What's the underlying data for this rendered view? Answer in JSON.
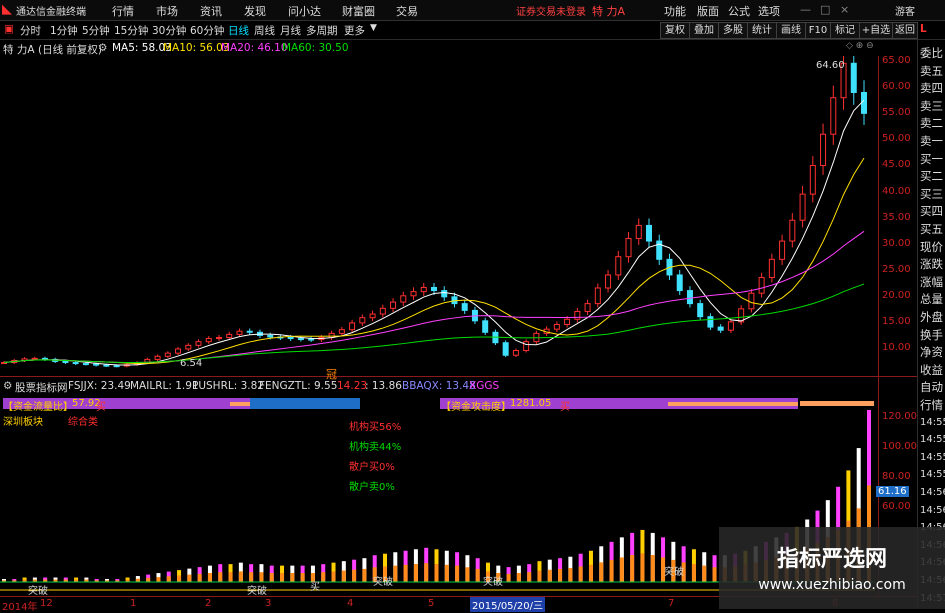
{
  "menubar": {
    "app_title": "通达信金融终端",
    "items": [
      "行情",
      "市场",
      "资讯",
      "发现",
      "问小达",
      "财富圈",
      "交易"
    ],
    "status": "证券交易未登录",
    "stock": "特 力A",
    "right_items": [
      "功能",
      "版面",
      "公式",
      "选项"
    ],
    "guest": "游客"
  },
  "periodbar": {
    "tabs": [
      "分时",
      "1分钟",
      "5分钟",
      "15分钟",
      "30分钟",
      "60分钟",
      "日线",
      "周线",
      "月线",
      "多周期",
      "更多"
    ],
    "active": "日线",
    "buttons": [
      "复权",
      "叠加",
      "多股",
      "统计",
      "画线",
      "F10",
      "标记",
      "+自选",
      "返回"
    ]
  },
  "price_panel": {
    "stock_label": "特 力A",
    "mode": "(日线 前复权)",
    "ma": [
      {
        "label": "MA5: 58.03",
        "color": "#ffffff"
      },
      {
        "label": "MA10: 56.03",
        "color": "#ffe000"
      },
      {
        "label": "MA20: 46.10",
        "color": "#ff40ff"
      },
      {
        "label": "MA60: 30.50",
        "color": "#00dd00"
      }
    ],
    "high_label": "64.60",
    "low_label": "6.54",
    "y_ticks": [
      "65.00",
      "60.00",
      "55.00",
      "50.00",
      "45.00",
      "40.00",
      "35.00",
      "30.00",
      "25.00",
      "20.00",
      "15.00",
      "10.00"
    ],
    "event_marker": "冠"
  },
  "indicator_panel": {
    "header": "股票指标网",
    "values": [
      {
        "label": "FSJJX: 23.49",
        "color": "#dddddd"
      },
      {
        "label": "MAILRL: 1.91",
        "color": "#dddddd"
      },
      {
        "label": "PUSHRL: 3.82",
        "color": "#dddddd"
      },
      {
        "label": "FENGZTL: 9.55",
        "color": "#dddddd"
      },
      {
        "label": "14.23",
        "color": "#ff3030"
      },
      {
        "label": ": 13.86",
        "color": "#dddddd"
      },
      {
        "label": "BBAQX: 13.48",
        "color": "#8888ff"
      },
      {
        "label": "XGGS",
        "color": "#ff40ff"
      }
    ],
    "flow_label": "【资金流量比】",
    "flow_value": "57.92",
    "flow_side": "买",
    "attack_label": "【资金攻击度】",
    "attack_value": "1281.05",
    "attack_side": "买",
    "board": "深圳板块",
    "concept": "综合类",
    "stats": [
      {
        "label": "机构买56%",
        "color": "#ff3030"
      },
      {
        "label": "机构卖44%",
        "color": "#00dd00"
      },
      {
        "label": "散户买0%",
        "color": "#ff3030"
      },
      {
        "label": "散户卖0%",
        "color": "#00dd00"
      }
    ],
    "breakouts": [
      "突破",
      "突破",
      "突破",
      "突破",
      "突破"
    ],
    "buy_label": "买",
    "last_value": "61.16",
    "y_ticks": [
      "120.00",
      "100.00",
      "80.00",
      "60.00"
    ]
  },
  "x_axis": {
    "labels": [
      "2014年",
      "12",
      "1",
      "2",
      "3",
      "4",
      "5",
      "2015/05/20/三",
      "7",
      "8"
    ]
  },
  "sidepanel": {
    "items": [
      "委比",
      "卖五",
      "卖四",
      "卖三",
      "卖二",
      "卖一",
      "买一",
      "买二",
      "买三",
      "买四",
      "买五",
      "现价",
      "涨跌",
      "涨幅",
      "总量",
      "外盘",
      "换手",
      "净资",
      "收益",
      "自动",
      "行情",
      "14:55",
      "14:55",
      "14:55",
      "14:55",
      "14:56",
      "14:56",
      "14:56",
      "14:56",
      "14:56",
      "14:56",
      "14:57"
    ]
  },
  "watermark": {
    "title": "指标严选网",
    "url": "www.xuezhibiao.com"
  },
  "chart_data": [
    {
      "type": "candlestick",
      "title": "特 力A (日线 前复权)",
      "ylim": [
        5,
        66
      ],
      "y_ticks": [
        10,
        15,
        20,
        25,
        30,
        35,
        40,
        45,
        50,
        55,
        60,
        65
      ],
      "series_price": [
        7.2,
        7.6,
        7.9,
        8.0,
        7.8,
        7.4,
        7.2,
        7.0,
        6.9,
        6.7,
        6.6,
        6.54,
        6.8,
        7.2,
        7.8,
        8.4,
        9.0,
        9.8,
        10.5,
        11.2,
        11.8,
        12.0,
        12.6,
        13.2,
        13.0,
        12.4,
        12.1,
        12.0,
        11.8,
        11.7,
        11.6,
        12.0,
        12.8,
        13.5,
        14.8,
        15.8,
        16.5,
        17.6,
        18.8,
        20.0,
        20.8,
        21.6,
        21.0,
        19.8,
        18.5,
        17.2,
        15.2,
        13.0,
        11.0,
        8.6,
        9.5,
        11.2,
        12.8,
        13.6,
        14.5,
        15.5,
        17.0,
        18.5,
        21.5,
        24.0,
        27.5,
        31.0,
        33.5,
        30.5,
        27.0,
        24.0,
        21.0,
        18.5,
        16.0,
        14.0,
        13.4,
        15.0,
        17.5,
        20.5,
        23.5,
        27.0,
        30.5,
        34.5,
        39.5,
        45.0,
        51.0,
        58.0,
        64.6,
        59.0,
        55.0
      ],
      "high": 64.6,
      "low": 6.54,
      "ma": {
        "MA5": 58.03,
        "MA10": 56.03,
        "MA20": 46.1,
        "MA60": 30.5
      }
    },
    {
      "type": "bar",
      "title": "股票指标网",
      "ylim": [
        0,
        125
      ],
      "y_ticks": [
        60,
        80,
        100,
        120
      ],
      "series_bars": [
        2,
        2,
        3,
        3,
        3,
        3,
        3,
        3,
        3,
        2,
        2,
        2,
        3,
        4,
        5,
        6,
        7,
        8,
        9,
        10,
        11,
        12,
        12,
        13,
        12,
        12,
        11,
        11,
        11,
        11,
        11,
        12,
        13,
        14,
        15,
        16,
        18,
        19,
        20,
        21,
        22,
        23,
        22,
        21,
        20,
        18,
        16,
        13,
        11,
        10,
        11,
        12,
        14,
        15,
        16,
        17,
        19,
        21,
        24,
        27,
        30,
        33,
        35,
        33,
        30,
        27,
        24,
        22,
        20,
        18,
        18,
        19,
        21,
        24,
        27,
        30,
        33,
        37,
        42,
        48,
        55,
        64,
        75,
        90,
        118
      ],
      "last": 61.16
    }
  ]
}
